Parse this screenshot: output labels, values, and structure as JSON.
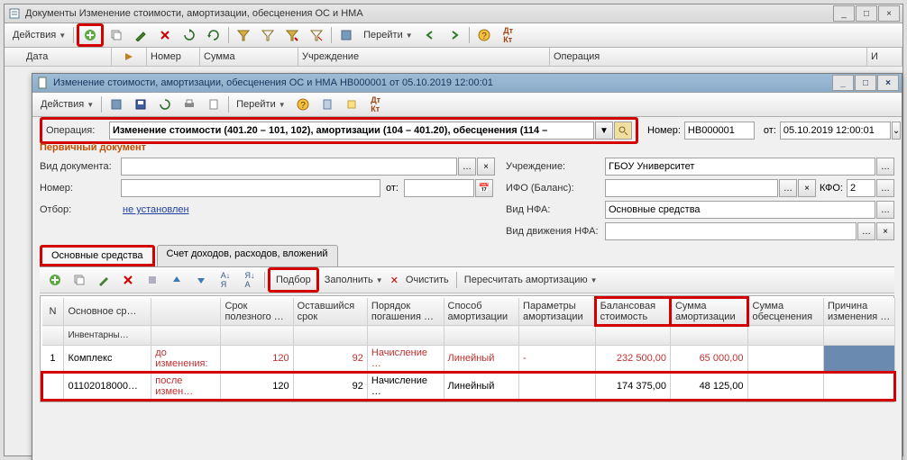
{
  "outer": {
    "title": "Документы  Изменение стоимости, амортизации, обесценения ОС и НМА",
    "toolbar": {
      "actions": "Действия",
      "goto": "Перейти"
    },
    "grid_headers": {
      "date": "Дата",
      "number": "Номер",
      "sum": "Сумма",
      "institution": "Учреждение",
      "operation": "Операция",
      "i": "И"
    }
  },
  "inner": {
    "title": "Изменение стоимости, амортизации, обесценения ОС и НМА НВ000001 от 05.10.2019 12:00:01",
    "toolbar": {
      "actions": "Действия",
      "goto": "Перейти"
    },
    "op_label": "Операция:",
    "op_value": "Изменение стоимости (401.20 – 101, 102), амортизации (104 – 401.20), обесценения (114 –",
    "num_label": "Номер:",
    "num_value": "НВ000001",
    "from_label": "от:",
    "from_value": "05.10.2019 12:00:01",
    "section": "Первичный документ",
    "doc_type_label": "Вид документа:",
    "number_label": "Номер:",
    "ot_label": "от:",
    "filter_label": "Отбор:",
    "filter_link": "не установлен",
    "inst_label": "Учреждение:",
    "inst_value": "ГБОУ Университет",
    "ifo_label": "ИФО (Баланс):",
    "kfo_label": "КФО:",
    "kfo_value": "2",
    "nfa_label": "Вид НФА:",
    "nfa_value": "Основные средства",
    "move_label": "Вид движения НФА:",
    "tabs": {
      "t1": "Основные средства",
      "t2": "Счет доходов, расходов, вложений"
    },
    "sub_tb": {
      "podbor": "Подбор",
      "zapolnit": "Заполнить",
      "ochistit": "Очистить",
      "recalc": "Пересчитать амортизацию"
    },
    "tbl": {
      "h_n": "N",
      "h_os": "Основное ср…",
      "h_inv": "Инвентарны…",
      "h_srok": "Срок полезного …",
      "h_ost": "Оставшийся срок",
      "h_por": "Порядок погашения …",
      "h_sposob": "Способ амортизации",
      "h_param": "Параметры амортизации",
      "h_bal": "Балансовая стоимость",
      "h_sum": "Сумма амортизации",
      "h_obes": "Сумма обесценения",
      "h_reason": "Причина изменения …",
      "r1_n": "1",
      "r1_os": "Комплекс",
      "r1_inv": "01102018000…",
      "r1_before": "до изменения:",
      "r1_after": "после измен…",
      "r1_srok_b": "120",
      "r1_srok_a": "120",
      "r1_ost_b": "92",
      "r1_ost_a": "92",
      "r1_por_b": "Начисление …",
      "r1_por_a": "Начисление …",
      "r1_sp_b": "Линейный",
      "r1_sp_a": "Линейный",
      "r1_par_b": "-",
      "r1_bal_b": "232 500,00",
      "r1_bal_a": "174 375,00",
      "r1_amort_b": "65 000,00",
      "r1_amort_a": "48 125,00"
    }
  }
}
